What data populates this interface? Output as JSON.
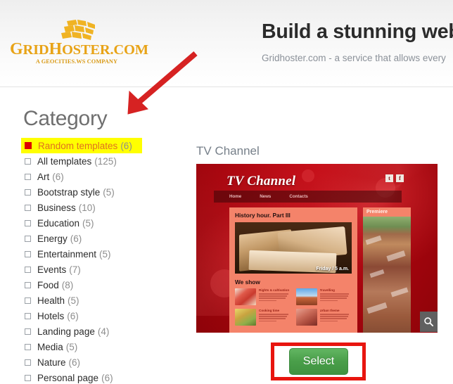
{
  "header": {
    "logo": {
      "name": "GridHoster.com",
      "word_parts": [
        "G",
        "RID",
        "H",
        "OSTER",
        ".COM"
      ],
      "tagline": "A Geocities.ws Company",
      "tagline_parts": [
        "A G",
        "EOCITIES",
        ".",
        "WS",
        " C",
        "OMPANY"
      ],
      "color": "#e8a317"
    },
    "title": "Build a stunning web",
    "subtitle": "Gridhoster.com - a service that allows every"
  },
  "sidebar": {
    "heading": "Category",
    "items": [
      {
        "label": "Random templates",
        "count": "(6)",
        "selected": true
      },
      {
        "label": "All templates",
        "count": "(125)",
        "selected": false
      },
      {
        "label": "Art",
        "count": "(6)",
        "selected": false
      },
      {
        "label": "Bootstrap style",
        "count": "(5)",
        "selected": false
      },
      {
        "label": "Business",
        "count": "(10)",
        "selected": false
      },
      {
        "label": "Education",
        "count": "(5)",
        "selected": false
      },
      {
        "label": "Energy",
        "count": "(6)",
        "selected": false
      },
      {
        "label": "Entertainment",
        "count": "(5)",
        "selected": false
      },
      {
        "label": "Events",
        "count": "(7)",
        "selected": false
      },
      {
        "label": "Food",
        "count": "(8)",
        "selected": false
      },
      {
        "label": "Health",
        "count": "(5)",
        "selected": false
      },
      {
        "label": "Hotels",
        "count": "(6)",
        "selected": false
      },
      {
        "label": "Landing page",
        "count": "(4)",
        "selected": false
      },
      {
        "label": "Media",
        "count": "(5)",
        "selected": false
      },
      {
        "label": "Nature",
        "count": "(6)",
        "selected": false
      },
      {
        "label": "Personal page",
        "count": "(6)",
        "selected": false
      }
    ],
    "highlight_color": "#ffff00",
    "selected_text_color": "#e07020",
    "selected_box_color": "#dd0000"
  },
  "preview": {
    "template_name": "TV Channel",
    "thumbnail": {
      "brand": "TV Channel",
      "nav": [
        "Home",
        "News",
        "Contacts"
      ],
      "social": [
        "t",
        "f"
      ],
      "feature_heading": "History hour. Part III",
      "feature_caption": "Friday / 5 a.m.",
      "section_heading": "We show",
      "articles": [
        {
          "title": "Rights & cultivation"
        },
        {
          "title": "Travelling"
        },
        {
          "title": "Cooking time"
        },
        {
          "title": "Urban theme"
        }
      ],
      "aside_heading": "Premiere",
      "accent_color": "#b2000a"
    },
    "zoom_icon": "magnifier-icon"
  },
  "actions": {
    "select_label": "Select",
    "select_color": "#4a9f4a",
    "annotation_color": "#e8150f"
  },
  "annotations": {
    "arrow_color": "#d62222",
    "arrow_target": "Category"
  }
}
